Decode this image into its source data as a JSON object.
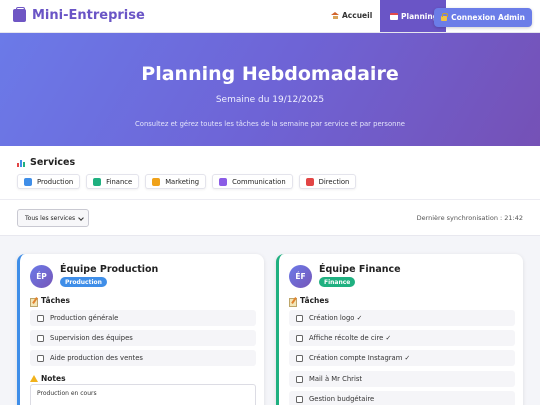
{
  "header": {
    "brand": "Mini-Entreprise",
    "nav": [
      {
        "label": "Accueil",
        "icon": "home-icon"
      },
      {
        "label": "Planning",
        "icon": "calendar-icon",
        "active": true
      }
    ],
    "admin_button": "Connexion Admin"
  },
  "hero": {
    "title": "Planning Hebdomadaire",
    "week": "Semaine du 19/12/2025",
    "subtitle": "Consultez et gérez toutes les tâches de la semaine par service et par personne"
  },
  "services": {
    "title": "Services",
    "items": [
      {
        "label": "Production",
        "color": "#3f8ee8"
      },
      {
        "label": "Finance",
        "color": "#1fb080"
      },
      {
        "label": "Marketing",
        "color": "#f0a21a"
      },
      {
        "label": "Communication",
        "color": "#8b5ce6"
      },
      {
        "label": "Direction",
        "color": "#e24545"
      }
    ]
  },
  "filter": {
    "select_value": "Tous les services",
    "sync": "Dernière synchronisation : 21:42"
  },
  "teams": [
    {
      "initials": "ÉP",
      "name": "Équipe Production",
      "badge": "Production",
      "tasks_label": "Tâches",
      "tasks": [
        "Production générale",
        "Supervision des équipes",
        "Aide production des ventes"
      ],
      "notes_label": "Notes",
      "notes": "Production en cours"
    },
    {
      "initials": "ÉF",
      "name": "Équipe Finance",
      "badge": "Finance",
      "tasks_label": "Tâches",
      "tasks": [
        "Création logo ✓",
        "Affiche récolte de cire ✓",
        "Création compte Instagram ✓",
        "Mail à Mr Christ",
        "Gestion budgétaire"
      ]
    }
  ]
}
